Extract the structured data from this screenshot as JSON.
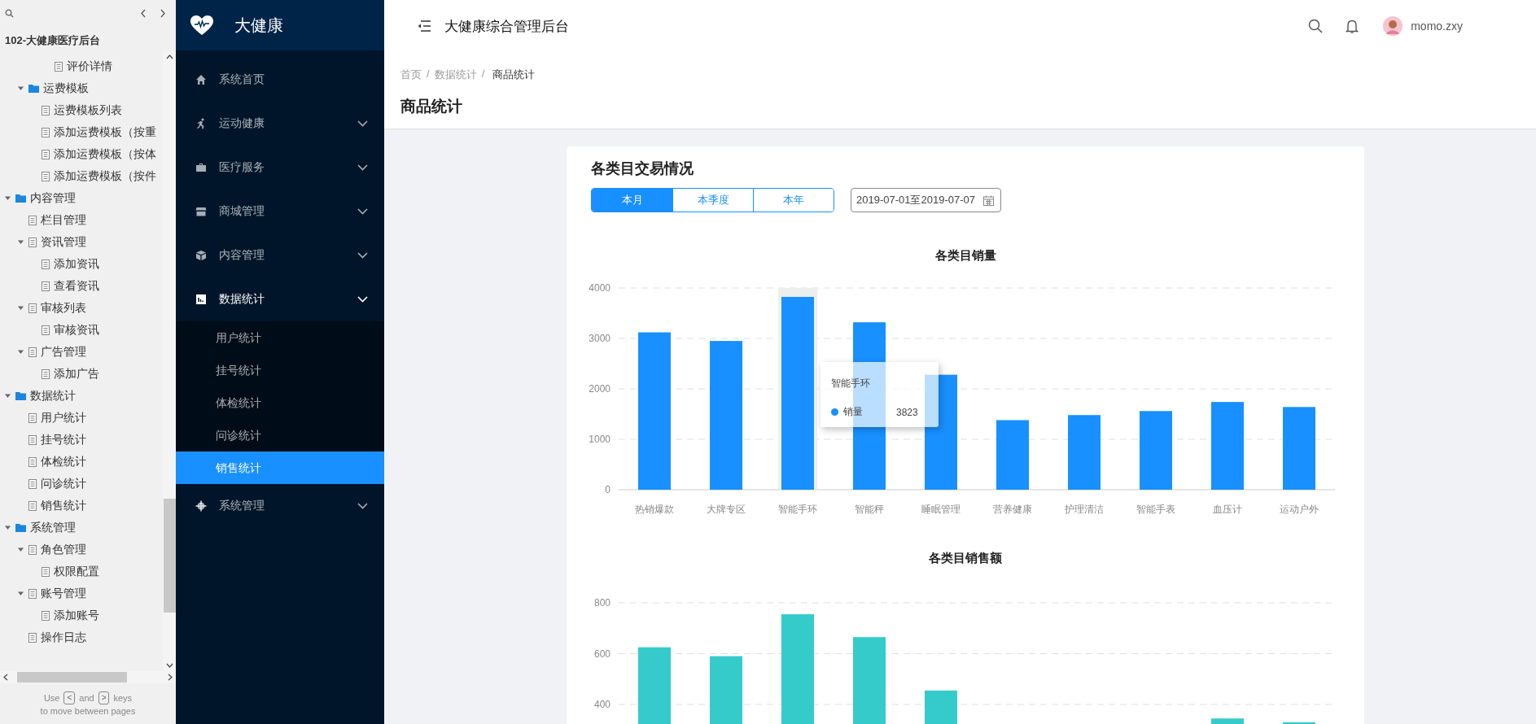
{
  "outline_panel": {
    "title": "102-大健康医疗后台",
    "tree": [
      {
        "children": [
          {
            "children": [
              {
                "children": [
                  {
                    "label": "评价详情",
                    "kind": "page"
                  }
                ]
              }
            ]
          },
          {
            "label": "运费模板",
            "kind": "folder",
            "expanded": true,
            "children": [
              {
                "label": "运费模板列表",
                "kind": "page"
              },
              {
                "label": "添加运费模板（按重",
                "kind": "page"
              },
              {
                "label": "添加运费模板（按体",
                "kind": "page"
              },
              {
                "label": "添加运费模板（按件",
                "kind": "page"
              }
            ]
          }
        ]
      },
      {
        "label": "内容管理",
        "kind": "folder",
        "expanded": true,
        "children": [
          {
            "label": "栏目管理",
            "kind": "page"
          },
          {
            "label": "资讯管理",
            "kind": "page",
            "expanded": true,
            "children": [
              {
                "label": "添加资讯",
                "kind": "page"
              },
              {
                "label": "查看资讯",
                "kind": "page"
              }
            ]
          },
          {
            "label": "审核列表",
            "kind": "page",
            "expanded": true,
            "children": [
              {
                "label": "审核资讯",
                "kind": "page"
              }
            ]
          },
          {
            "label": "广告管理",
            "kind": "page",
            "expanded": true,
            "children": [
              {
                "label": "添加广告",
                "kind": "page"
              }
            ]
          }
        ]
      },
      {
        "label": "数据统计",
        "kind": "folder",
        "expanded": true,
        "children": [
          {
            "label": "用户统计",
            "kind": "page"
          },
          {
            "label": "挂号统计",
            "kind": "page"
          },
          {
            "label": "体检统计",
            "kind": "page"
          },
          {
            "label": "问诊统计",
            "kind": "page"
          },
          {
            "label": "销售统计",
            "kind": "page"
          }
        ]
      },
      {
        "label": "系统管理",
        "kind": "folder",
        "expanded": true,
        "children": [
          {
            "label": "角色管理",
            "kind": "page",
            "expanded": true,
            "children": [
              {
                "label": "权限配置",
                "kind": "page"
              }
            ]
          },
          {
            "label": "账号管理",
            "kind": "page",
            "expanded": true,
            "children": [
              {
                "label": "添加账号",
                "kind": "page"
              }
            ]
          },
          {
            "label": "操作日志",
            "kind": "page"
          }
        ]
      }
    ],
    "hint": {
      "before": "Use",
      "key_prev": "<",
      "middle": "and",
      "key_next": ">",
      "after": "keys",
      "line2": "to move between pages"
    }
  },
  "sidebar": {
    "brand": "大健康",
    "menu": [
      {
        "label": "系统首页"
      },
      {
        "label": "运动健康",
        "expanded": false
      },
      {
        "label": "医疗服务",
        "expanded": false
      },
      {
        "label": "商城管理",
        "expanded": false
      },
      {
        "label": "内容管理",
        "expanded": false
      },
      {
        "label": "数据统计",
        "expanded": true,
        "children": [
          {
            "label": "用户统计",
            "selected": false
          },
          {
            "label": "挂号统计",
            "selected": false
          },
          {
            "label": "体检统计",
            "selected": false
          },
          {
            "label": "问诊统计",
            "selected": false
          },
          {
            "label": "销售统计",
            "selected": true
          }
        ]
      },
      {
        "label": "系统管理",
        "expanded": false
      }
    ]
  },
  "header": {
    "title": "大健康综合管理后台",
    "username": "momo.zxy"
  },
  "breadcrumb": {
    "items": [
      "首页",
      "数据统计",
      "商品统计"
    ],
    "separator": "/"
  },
  "page_title": "商品统计",
  "card": {
    "title": "各类目交易情况",
    "tabs": [
      {
        "label": "本月",
        "selected": true
      },
      {
        "label": "本季度",
        "selected": false
      },
      {
        "label": "本年",
        "selected": false
      }
    ],
    "date_range": {
      "value": "2019-07-01至2019-07-07"
    },
    "charts": [
      {
        "chart_data": {
          "type": "bar",
          "title": "各类目销量",
          "categories": [
            "热销爆款",
            "大牌专区",
            "智能手环",
            "智能秤",
            "睡眠管理",
            "营养健康",
            "护理清洁",
            "智能手表",
            "血压计",
            "运动户外"
          ],
          "series": [
            {
              "name": "销量",
              "color": "#1890ff",
              "values": [
                3120,
                2950,
                3823,
                3320,
                2280,
                1380,
                1480,
                1560,
                1740,
                1640
              ]
            }
          ],
          "ylim": [
            0,
            4000
          ],
          "yticks": [
            0,
            1000,
            2000,
            3000,
            4000
          ],
          "grid": true
        },
        "hover": [
          false,
          false,
          true,
          false,
          false,
          false,
          false,
          false,
          false,
          false
        ],
        "tooltip": {
          "title": "智能手环",
          "value": "3823"
        }
      },
      {
        "chart_data": {
          "type": "bar",
          "title": "各类目销售额",
          "series": [
            {
              "color": "#36cbcb",
              "values": [
                625,
                590,
                755,
                665,
                455,
                null,
                null,
                null,
                345,
                330
              ]
            }
          ],
          "ylim": [
            320,
            800
          ],
          "yticks": [
            400,
            600,
            800
          ],
          "grid": true
        }
      }
    ]
  }
}
